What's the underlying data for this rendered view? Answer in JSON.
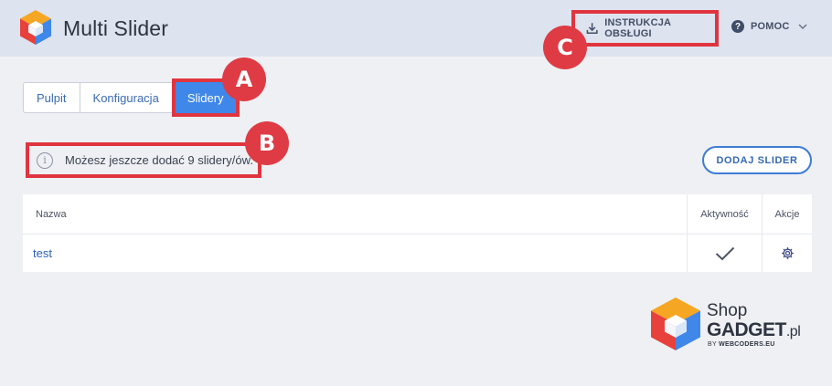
{
  "header": {
    "app_title": "Multi Slider",
    "manual_label": "INSTRUKCJA OBSŁUGI",
    "help_label": "POMOC"
  },
  "tabs": [
    {
      "label": "Pulpit",
      "active": false
    },
    {
      "label": "Konfiguracja",
      "active": false
    },
    {
      "label": "Slidery",
      "active": true
    }
  ],
  "notice": {
    "text": "Możesz jeszcze dodać 9 slidery/ów."
  },
  "add_button_label": "DODAJ SLIDER",
  "table": {
    "headers": [
      "Nazwa",
      "Aktywność",
      "Akcje"
    ],
    "rows": [
      {
        "name": "test",
        "active": true
      }
    ]
  },
  "annotations": {
    "a": "A",
    "b": "B",
    "c": "C"
  },
  "brand": {
    "shop": "Shop",
    "gadget": "GADGET",
    "tld": ".pl",
    "by_prefix": "BY",
    "by_name": "WEBCODERS.EU"
  },
  "colors": {
    "accent": "#3f87e9",
    "highlight": "#e0353f",
    "header_bg": "#dde3ef"
  },
  "icons": {
    "manual": "download-icon",
    "help": "question-circle-icon",
    "notice": "info-icon",
    "active": "checkmark-icon",
    "action": "gear-icon"
  }
}
